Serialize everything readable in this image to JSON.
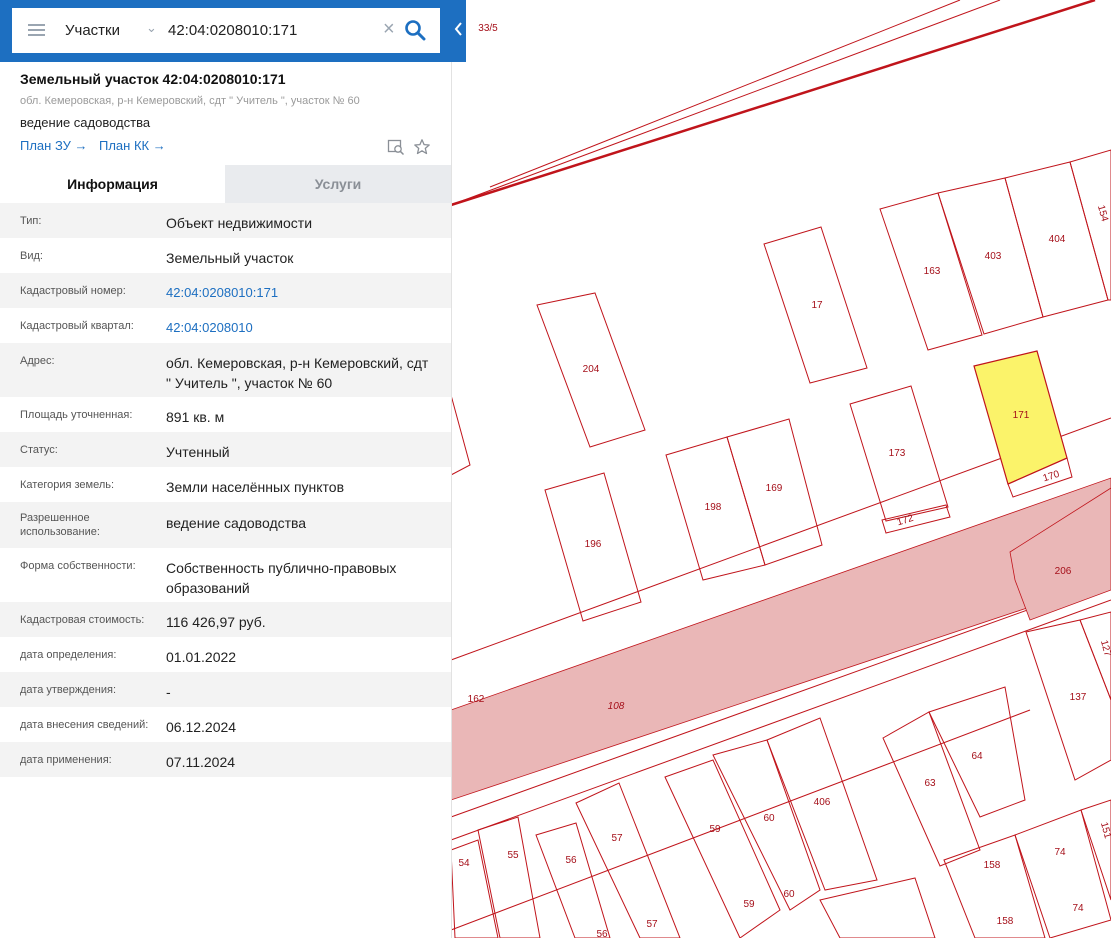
{
  "search": {
    "layer_select": "Участки",
    "query": "42:04:0208010:171"
  },
  "map": {
    "parcel_labels": [
      "33/5",
      "154",
      "404",
      "403",
      "163",
      "17",
      "204",
      "171",
      "173",
      "170",
      "172",
      "169",
      "198",
      "196",
      "206",
      "127",
      "137",
      "162",
      "108",
      "64",
      "63",
      "406",
      "60",
      "59",
      "59",
      "60",
      "57",
      "57",
      "56",
      "56",
      "55",
      "54",
      "151",
      "74",
      "74",
      "158",
      "158"
    ],
    "highlight_label": "171",
    "colors": {
      "boundary": "#c0141b",
      "highlight_fill": "#fbf36a",
      "road_fill": "#eab7b7"
    }
  },
  "card": {
    "title": "Земельный участок 42:04:0208010:171",
    "address": "обл. Кемеровская, р-н Кемеровский, сдт \" Учитель \", участок № 60",
    "purpose": "ведение садоводства",
    "plan_zu": "План ЗУ →",
    "plan_kk": "План КК →",
    "icons": [
      "map-search-icon",
      "star-icon"
    ]
  },
  "tabs": {
    "info": "Информация",
    "services": "Услуги"
  },
  "rows": [
    {
      "label": "Тип:",
      "value": "Объект недвижимости"
    },
    {
      "label": "Вид:",
      "value": "Земельный участок"
    },
    {
      "label": "Кадастровый номер:",
      "value": "42:04:0208010:171"
    },
    {
      "label": "Кадастровый квартал:",
      "value": "42:04:0208010"
    },
    {
      "label": "Адрес:",
      "value": "обл. Кемеровская, р-н Кемеровский, сдт \" Учитель \", участок № 60"
    },
    {
      "label": "Площадь уточненная:",
      "value": "891 кв. м"
    },
    {
      "label": "Статус:",
      "value": "Учтенный"
    },
    {
      "label": "Категория земель:",
      "value": "Земли населённых пунктов"
    },
    {
      "label": "Разрешенное использование:",
      "value": "ведение садоводства"
    },
    {
      "label": "Форма собственности:",
      "value": "Собственность публично-правовых образований"
    },
    {
      "label": "Кадастровая стоимость:",
      "value": "116 426,97 руб."
    },
    {
      "label": "дата определения:",
      "value": "01.01.2022"
    },
    {
      "label": "дата утверждения:",
      "value": "-"
    },
    {
      "label": "дата внесения сведений:",
      "value": "06.12.2024"
    },
    {
      "label": "дата применения:",
      "value": "07.11.2024"
    }
  ]
}
